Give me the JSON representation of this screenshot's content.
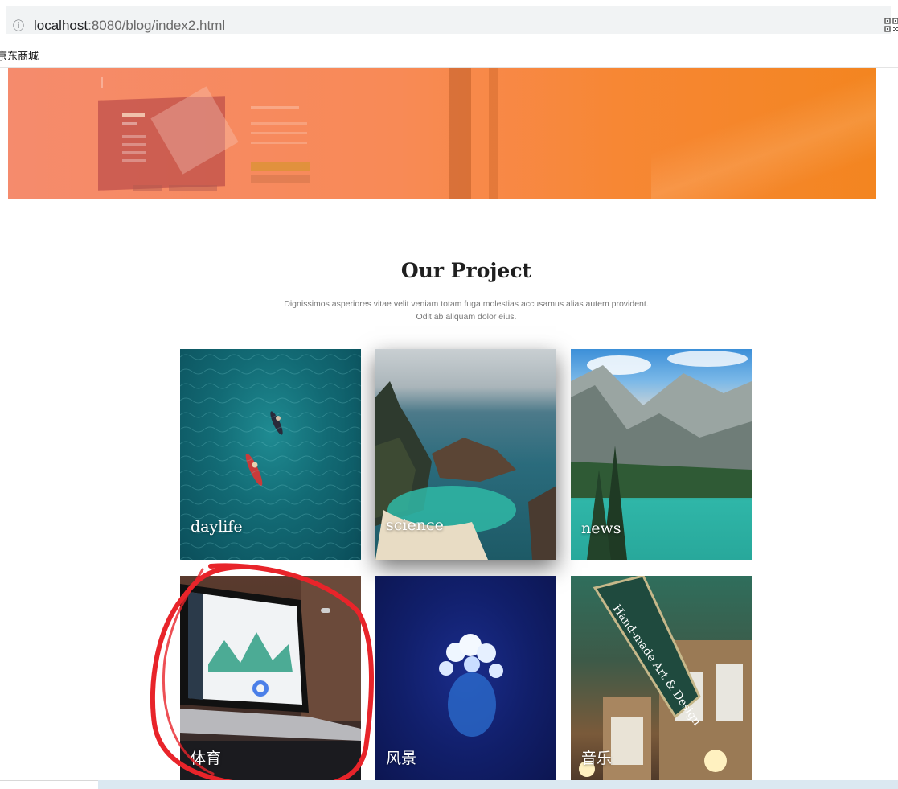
{
  "browser": {
    "url_host": "localhost",
    "url_rest": ":8080/blog/index2.html",
    "bookmark": "京东商城",
    "icons": [
      "site-info-icon",
      "qr-code-icon"
    ]
  },
  "project": {
    "title": "Our Project",
    "description": "Dignissimos asperiores vitae velit veniam totam fuga molestias accusamus alias autem provident. Odit ab aliquam dolor eius."
  },
  "cards": [
    {
      "label": "daylife"
    },
    {
      "label": "science"
    },
    {
      "label": "news"
    },
    {
      "label": "体育"
    },
    {
      "label": "风景"
    },
    {
      "label": "音乐"
    }
  ],
  "colors": {
    "hero_start": "#f58b6d",
    "hero_end": "#f38520",
    "annotation": "#e8242a"
  }
}
